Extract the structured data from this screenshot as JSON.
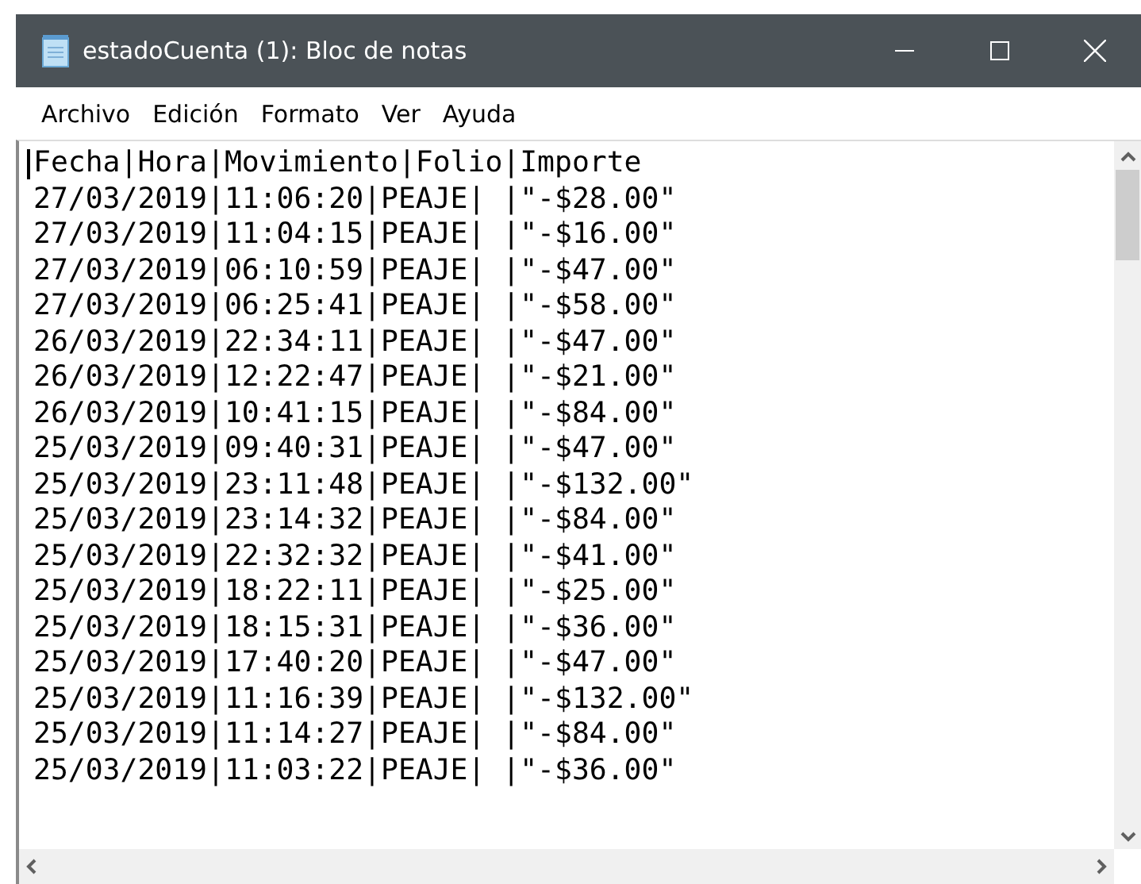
{
  "window": {
    "title": "estadoCuenta (1): Bloc de notas"
  },
  "menu": [
    "Archivo",
    "Edición",
    "Formato",
    "Ver",
    "Ayuda"
  ],
  "lines": [
    "Fecha|Hora|Movimiento|Folio|Importe",
    "27/03/2019|11:06:20|PEAJE| |\"-$28.00\"",
    "27/03/2019|11:04:15|PEAJE| |\"-$16.00\"",
    "27/03/2019|06:10:59|PEAJE| |\"-$47.00\"",
    "27/03/2019|06:25:41|PEAJE| |\"-$58.00\"",
    "26/03/2019|22:34:11|PEAJE| |\"-$47.00\"",
    "26/03/2019|12:22:47|PEAJE| |\"-$21.00\"",
    "26/03/2019|10:41:15|PEAJE| |\"-$84.00\"",
    "25/03/2019|09:40:31|PEAJE| |\"-$47.00\"",
    "25/03/2019|23:11:48|PEAJE| |\"-$132.00\"",
    "25/03/2019|23:14:32|PEAJE| |\"-$84.00\"",
    "25/03/2019|22:32:32|PEAJE| |\"-$41.00\"",
    "25/03/2019|18:22:11|PEAJE| |\"-$25.00\"",
    "25/03/2019|18:15:31|PEAJE| |\"-$36.00\"",
    "25/03/2019|17:40:20|PEAJE| |\"-$47.00\"",
    "25/03/2019|11:16:39|PEAJE| |\"-$132.00\"",
    "25/03/2019|11:14:27|PEAJE| |\"-$84.00\"",
    "25/03/2019|11:03:22|PEAJE| |\"-$36.00\""
  ]
}
